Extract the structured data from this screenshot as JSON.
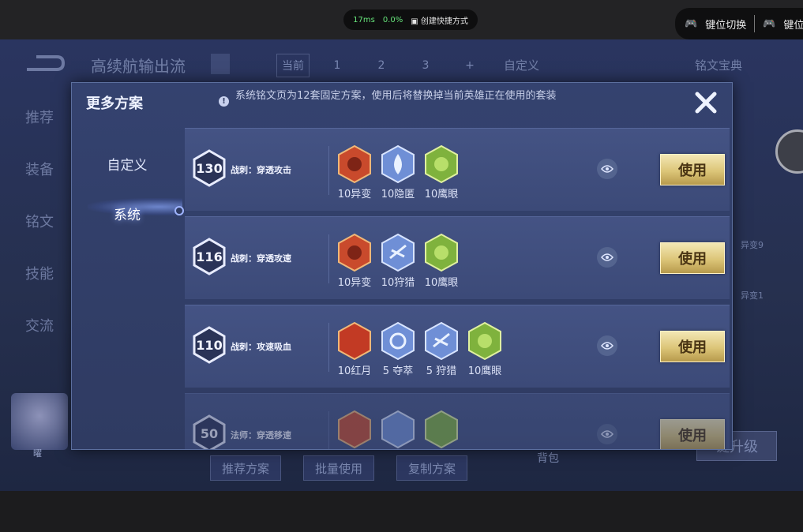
{
  "overlay": {
    "latency": "17ms",
    "loss": "0.0%",
    "shortcut_label": "创建快捷方式",
    "key_switch_label": "键位切换",
    "key_switch_label_2": "键位"
  },
  "game": {
    "title": "高续航输出流",
    "tabs": [
      "当前",
      "1",
      "2",
      "3",
      "+"
    ],
    "custom_label": "自定义",
    "rune_book_label": "铭文宝典",
    "sidebar": [
      "推荐",
      "装备",
      "铭文",
      "技能",
      "交流"
    ],
    "bottom_buttons": [
      "推荐方案",
      "批量使用",
      "复制方案"
    ],
    "backpack_label": "背包",
    "upgrade_label": "键升级",
    "right_runes": [
      "异变9",
      "异变1"
    ],
    "hero_label": "曜"
  },
  "modal": {
    "title": "更多方案",
    "notice": "系统铭文页为12套固定方案，使用后将替换掉当前英雄正在使用的套装",
    "tabs": [
      {
        "label": "自定义",
        "active": false
      },
      {
        "label": "系统",
        "active": true
      }
    ],
    "use_label": "使用",
    "plans": [
      {
        "level": "130",
        "name": "战刺：穿透攻击",
        "runes": [
          {
            "label": "10异变",
            "icon": "red-rune-icon",
            "color": "#c94a2c"
          },
          {
            "label": "10隐匿",
            "icon": "blue-rune-icon",
            "color": "#6f8fd6"
          },
          {
            "label": "10鹰眼",
            "icon": "green-rune-icon",
            "color": "#7fb23d"
          }
        ]
      },
      {
        "level": "116",
        "name": "战刺：穿透攻速",
        "runes": [
          {
            "label": "10异变",
            "icon": "red-rune-icon",
            "color": "#c94a2c"
          },
          {
            "label": "10狩猎",
            "icon": "blue-rune-icon",
            "color": "#6f8fd6"
          },
          {
            "label": "10鹰眼",
            "icon": "green-rune-icon",
            "color": "#7fb23d"
          }
        ]
      },
      {
        "level": "110",
        "name": "战刺：攻速吸血",
        "runes": [
          {
            "label": "10红月",
            "icon": "red-rune-icon",
            "color": "#c23a24"
          },
          {
            "label": "5 夺萃",
            "icon": "blue-rune-icon",
            "color": "#6f8fd6"
          },
          {
            "label": "5 狩猎",
            "icon": "blue-rune-icon",
            "color": "#6f8fd6"
          },
          {
            "label": "10鹰眼",
            "icon": "green-rune-icon",
            "color": "#7fb23d"
          }
        ]
      },
      {
        "level": "50",
        "name": "法师：穿透移速",
        "runes": [
          {
            "label": "",
            "icon": "red-rune-icon",
            "color": "#c94a2c"
          },
          {
            "label": "",
            "icon": "blue-rune-icon",
            "color": "#6f8fd6"
          },
          {
            "label": "",
            "icon": "green-rune-icon",
            "color": "#7fb23d"
          }
        ]
      }
    ]
  }
}
